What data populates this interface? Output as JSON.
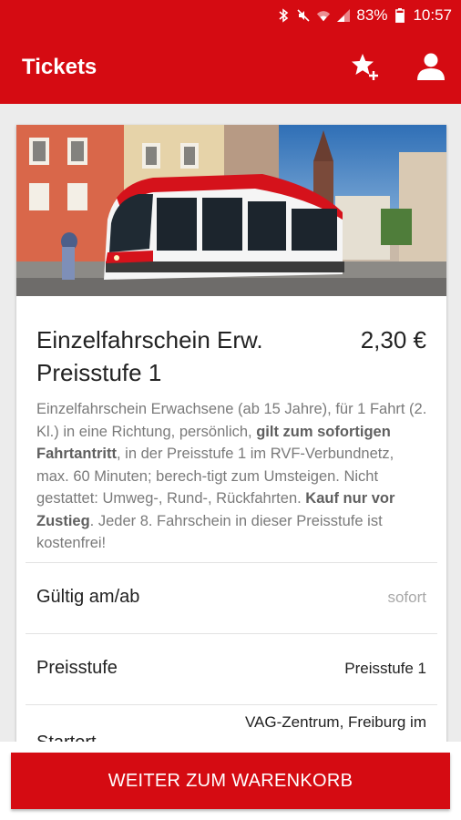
{
  "status_bar": {
    "battery": "83%",
    "time": "10:57"
  },
  "app_bar": {
    "title": "Tickets"
  },
  "ticket": {
    "title": "Einzelfahrschein Erw. Preisstufe 1",
    "price": "2,30 €",
    "description": {
      "part1": "Einzelfahrschein Erwachsene (ab 15 Jahre), für 1 Fahrt (2. Kl.) in eine Richtung, persönlich, ",
      "bold1": "gilt zum sofortigen Fahrtantritt",
      "part2": ", in der Preisstufe 1 im RVF-Verbundnetz, max. 60 Minuten; berech-tigt zum Umsteigen. Nicht gestattet: Umweg-, Rund-, Rückfahrten. ",
      "bold2": "Kauf nur vor Zustieg",
      "part3": ". Jeder 8. Fahrschein in dieser Preisstufe ist kostenfrei!"
    }
  },
  "details": [
    {
      "label": "Gültig am/ab",
      "value": "sofort"
    },
    {
      "label": "Preisstufe",
      "value": "Preisstufe 1"
    },
    {
      "label": "Startort",
      "value": "VAG-Zentrum, Freiburg im"
    }
  ],
  "cta": {
    "label": "WEITER ZUM WARENKORB"
  },
  "colors": {
    "brand_red": "#d50b12",
    "muted_text": "#a8a8a8"
  }
}
